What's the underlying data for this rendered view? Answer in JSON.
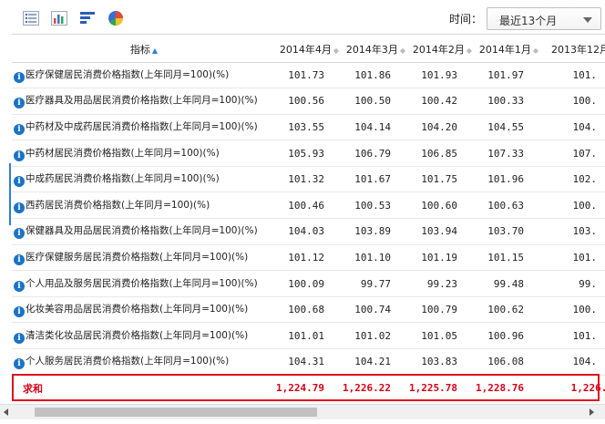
{
  "toolbar": {
    "icons": [
      "list-view-icon",
      "bar-chart-icon",
      "horizontal-bar-chart-icon",
      "pie-chart-icon"
    ],
    "period_label": "时间：",
    "period_value": "最近13个月"
  },
  "table": {
    "header_indicator": "指标",
    "columns": [
      "2014年4月",
      "2014年3月",
      "2014年2月",
      "2014年1月",
      "2013年12月"
    ],
    "rows": [
      {
        "label": "医疗保健居民消费价格指数(上年同月=100)(%)",
        "v": [
          "101.73",
          "101.86",
          "101.93",
          "101.97",
          "101."
        ]
      },
      {
        "label": "医疗器具及用品居民消费价格指数(上年同月=100)(%)",
        "v": [
          "100.56",
          "100.50",
          "100.42",
          "100.33",
          "100."
        ]
      },
      {
        "label": "中药材及中成药居民消费价格指数(上年同月=100)(%)",
        "v": [
          "103.55",
          "104.14",
          "104.20",
          "104.55",
          "104."
        ]
      },
      {
        "label": "中药材居民消费价格指数(上年同月=100)(%)",
        "v": [
          "105.93",
          "106.79",
          "106.85",
          "107.33",
          "107."
        ]
      },
      {
        "label": "中成药居民消费价格指数(上年同月=100)(%)",
        "v": [
          "101.32",
          "101.67",
          "101.75",
          "101.96",
          "102."
        ]
      },
      {
        "label": "西药居民消费价格指数(上年同月=100)(%)",
        "v": [
          "100.46",
          "100.53",
          "100.60",
          "100.63",
          "100."
        ]
      },
      {
        "label": "保健器具及用品居民消费价格指数(上年同月=100)(%)",
        "v": [
          "104.03",
          "103.89",
          "103.94",
          "103.70",
          "103."
        ]
      },
      {
        "label": "医疗保健服务居民消费价格指数(上年同月=100)(%)",
        "v": [
          "101.12",
          "101.10",
          "101.19",
          "101.15",
          "101."
        ]
      },
      {
        "label": "个人用品及服务居民消费价格指数(上年同月=100)(%)",
        "v": [
          "100.09",
          "99.77",
          "99.23",
          "99.48",
          "99."
        ]
      },
      {
        "label": "化妆美容用品居民消费价格指数(上年同月=100)(%)",
        "v": [
          "100.68",
          "100.74",
          "100.79",
          "100.62",
          "100."
        ]
      },
      {
        "label": "清洁类化妆品居民消费价格指数(上年同月=100)(%)",
        "v": [
          "101.01",
          "101.02",
          "101.05",
          "100.96",
          "101."
        ]
      },
      {
        "label": "个人服务居民消费价格指数(上年同月=100)(%)",
        "v": [
          "104.31",
          "104.21",
          "103.83",
          "106.08",
          "104."
        ]
      }
    ],
    "sum_row": {
      "label": "求和",
      "v": [
        "1,224.79",
        "1,226.22",
        "1,225.78",
        "1,228.76",
        "1,226.:"
      ]
    }
  },
  "colors": {
    "accent_blue": "#2b7fd6",
    "info_icon": "#1a73c8",
    "sum_red": "#d4021b"
  }
}
